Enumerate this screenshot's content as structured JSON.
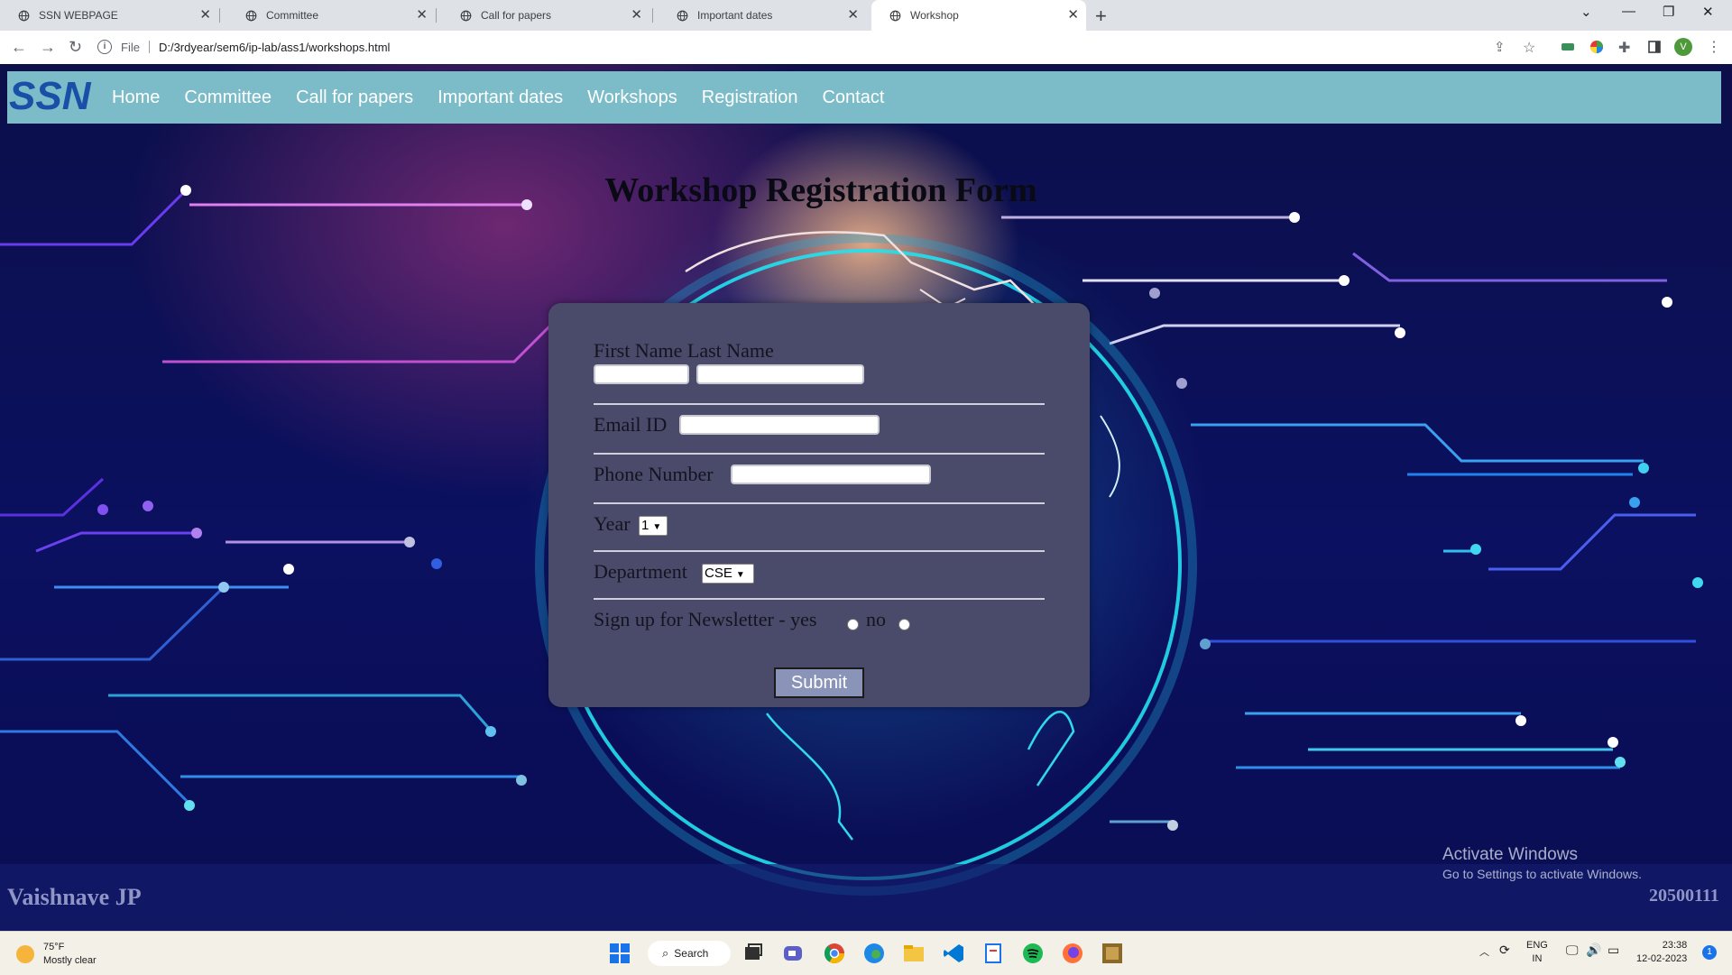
{
  "browser": {
    "tabs": [
      {
        "title": "SSN WEBPAGE",
        "active": false
      },
      {
        "title": "Committee",
        "active": false
      },
      {
        "title": "Call for papers",
        "active": false
      },
      {
        "title": "Important dates",
        "active": false
      },
      {
        "title": "Workshop",
        "active": true
      }
    ],
    "address": {
      "scheme_label": "File",
      "url": "D:/3rdyear/sem6/ip-lab/ass1/workshops.html"
    },
    "profile_initial": "V"
  },
  "site": {
    "logo_text": "SSN",
    "nav": [
      "Home",
      "Committee",
      "Call for papers",
      "Important dates",
      "Workshops",
      "Registration",
      "Contact"
    ],
    "heading": "Workshop Registration Form"
  },
  "form": {
    "name_label": "First Name Last Name",
    "email_label": "Email ID",
    "phone_label": "Phone Number",
    "year_label": "Year",
    "year_value": "1",
    "department_label": "Department",
    "department_value": "CSE",
    "newsletter_label": "Sign up for Newsletter - yes",
    "newsletter_no": "no",
    "submit_label": "Submit"
  },
  "footer": {
    "name": "Vaishnave JP",
    "roll": "20500111"
  },
  "watermark": {
    "line1": "Activate Windows",
    "line2": "Go to Settings to activate Windows."
  },
  "taskbar": {
    "weather_temp": "75°F",
    "weather_desc": "Mostly clear",
    "search_label": "Search",
    "lang_line1": "ENG",
    "lang_line2": "IN",
    "time": "23:38",
    "date": "12-02-2023",
    "notification_count": "1"
  },
  "colors": {
    "navbar": "#7bbcc8",
    "form_bg": "#4a4a6a",
    "submit_bg": "#8a94b8",
    "page_bg": "#0c0f4a"
  }
}
